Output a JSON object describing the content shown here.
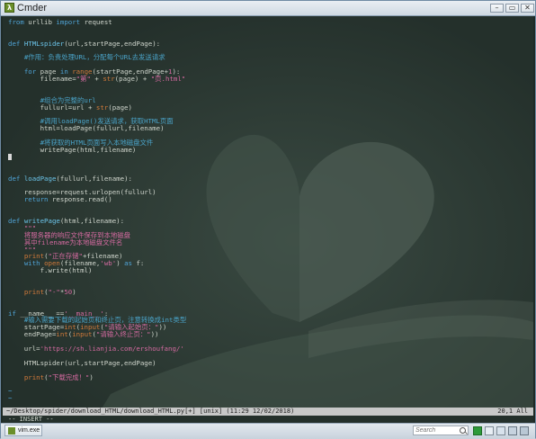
{
  "window": {
    "title": "Cmder"
  },
  "code_lines": [
    [
      {
        "t": "from",
        "c": "kw"
      },
      {
        "t": " urllib "
      },
      {
        "t": "import",
        "c": "kw"
      },
      {
        "t": " request"
      }
    ],
    [],
    [],
    [
      {
        "t": "def",
        "c": "kw"
      },
      {
        "t": " "
      },
      {
        "t": "HTMLspider",
        "c": "fn"
      },
      {
        "t": "(url,startPage,endPage):"
      }
    ],
    [],
    [
      {
        "t": "    "
      },
      {
        "t": "#作用：负责处理URL，分配每个URL去发送请求",
        "c": "cmt"
      }
    ],
    [],
    [
      {
        "t": "    "
      },
      {
        "t": "for",
        "c": "kw"
      },
      {
        "t": " page "
      },
      {
        "t": "in",
        "c": "kw"
      },
      {
        "t": " "
      },
      {
        "t": "range",
        "c": "bi"
      },
      {
        "t": "(startPage,endPage+"
      },
      {
        "t": "1",
        "c": "str"
      },
      {
        "t": "):"
      }
    ],
    [
      {
        "t": "        filename="
      },
      {
        "t": "\"第\"",
        "c": "str"
      },
      {
        "t": " + "
      },
      {
        "t": "str",
        "c": "bi"
      },
      {
        "t": "(page) + "
      },
      {
        "t": "\"页.html\"",
        "c": "str"
      }
    ],
    [],
    [],
    [
      {
        "t": "        "
      },
      {
        "t": "#组合为完整的url",
        "c": "cmt"
      }
    ],
    [
      {
        "t": "        fullurl=url + "
      },
      {
        "t": "str",
        "c": "bi"
      },
      {
        "t": "(page)"
      }
    ],
    [],
    [
      {
        "t": "        "
      },
      {
        "t": "#调用loadPage()发送请求，获取HTML页面",
        "c": "cmt"
      }
    ],
    [
      {
        "t": "        html=loadPage(fullurl,filename)"
      }
    ],
    [],
    [
      {
        "t": "        "
      },
      {
        "t": "#将获取的HTML页面写入本地磁盘文件",
        "c": "cmt"
      }
    ],
    [
      {
        "t": "        writePage(html,filename)"
      }
    ],
    [
      {
        "t": "",
        "cursor": true
      }
    ],
    [],
    [],
    [
      {
        "t": "def",
        "c": "kw"
      },
      {
        "t": " "
      },
      {
        "t": "loadPage",
        "c": "fn"
      },
      {
        "t": "(fullurl,filename):"
      }
    ],
    [],
    [
      {
        "t": "    response=request.urlopen(fullurl)"
      }
    ],
    [
      {
        "t": "    "
      },
      {
        "t": "return",
        "c": "kw"
      },
      {
        "t": " response.read()"
      }
    ],
    [],
    [],
    [
      {
        "t": "def",
        "c": "kw"
      },
      {
        "t": " "
      },
      {
        "t": "writePage",
        "c": "fn"
      },
      {
        "t": "(html,filename):"
      }
    ],
    [
      {
        "t": "    "
      },
      {
        "t": "\"\"\"",
        "c": "str"
      }
    ],
    [
      {
        "t": "    "
      },
      {
        "t": "将服务器的响应文件保存到本地磁盘",
        "c": "str"
      }
    ],
    [
      {
        "t": "    "
      },
      {
        "t": "其中filename为本地磁盘文件名",
        "c": "str"
      }
    ],
    [
      {
        "t": "    "
      },
      {
        "t": "\"\"\"",
        "c": "str"
      }
    ],
    [
      {
        "t": "    "
      },
      {
        "t": "print",
        "c": "bi"
      },
      {
        "t": "("
      },
      {
        "t": "\"正在存储\"",
        "c": "str"
      },
      {
        "t": "+filename)"
      }
    ],
    [
      {
        "t": "    "
      },
      {
        "t": "with",
        "c": "kw"
      },
      {
        "t": " "
      },
      {
        "t": "open",
        "c": "bi"
      },
      {
        "t": "(filename,"
      },
      {
        "t": "'wb'",
        "c": "str"
      },
      {
        "t": ") "
      },
      {
        "t": "as",
        "c": "kw"
      },
      {
        "t": " f:"
      }
    ],
    [
      {
        "t": "        f.write(html)"
      }
    ],
    [],
    [],
    [
      {
        "t": "    "
      },
      {
        "t": "print",
        "c": "bi"
      },
      {
        "t": "("
      },
      {
        "t": "\"-\"",
        "c": "str"
      },
      {
        "t": "*"
      },
      {
        "t": "50",
        "c": "str"
      },
      {
        "t": ")"
      }
    ],
    [],
    [],
    [
      {
        "t": "if",
        "c": "kw"
      },
      {
        "t": " __name__ =="
      },
      {
        "t": "'__main__'",
        "c": "str"
      },
      {
        "t": ":"
      }
    ],
    [
      {
        "t": "    "
      },
      {
        "t": "#输入需要下载的起始页和终止页，注意转换成int类型",
        "c": "cmt"
      }
    ],
    [
      {
        "t": "    startPage="
      },
      {
        "t": "int",
        "c": "bi"
      },
      {
        "t": "("
      },
      {
        "t": "input",
        "c": "bi"
      },
      {
        "t": "("
      },
      {
        "t": "\"请输入起始页：\"",
        "c": "str"
      },
      {
        "t": "))"
      }
    ],
    [
      {
        "t": "    endPage="
      },
      {
        "t": "int",
        "c": "bi"
      },
      {
        "t": "("
      },
      {
        "t": "input",
        "c": "bi"
      },
      {
        "t": "("
      },
      {
        "t": "\"请输入终止页：\"",
        "c": "str"
      },
      {
        "t": "))"
      }
    ],
    [],
    [
      {
        "t": "    url="
      },
      {
        "t": "'https://sh.lianjia.com/ershoufang/'",
        "c": "str"
      }
    ],
    [],
    [
      {
        "t": "    HTMLspider(url,startPage,endPage)"
      }
    ],
    [],
    [
      {
        "t": "    "
      },
      {
        "t": "print",
        "c": "bi"
      },
      {
        "t": "("
      },
      {
        "t": "\"下载完成！\"",
        "c": "str"
      },
      {
        "t": ")"
      }
    ],
    [],
    [
      {
        "t": "~",
        "c": "kw"
      }
    ],
    [
      {
        "t": "~",
        "c": "kw"
      }
    ]
  ],
  "statusbar": {
    "left": "~/Desktop/spider/download_HTML/download_HTML.py[+] [unix] (11:29 12/02/2018)",
    "right": "20,1 All"
  },
  "mode": "-- INSERT --",
  "taskbar": {
    "tab_label": "vim.exe",
    "search_placeholder": "Search"
  }
}
